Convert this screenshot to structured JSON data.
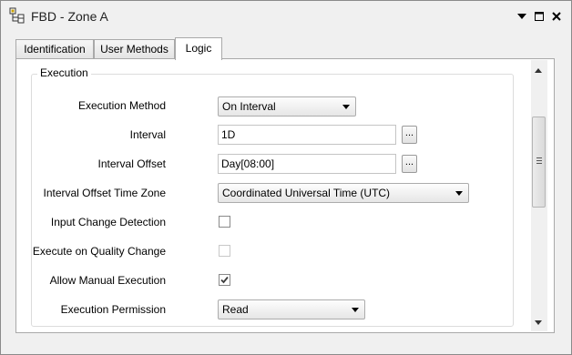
{
  "window": {
    "title": "FBD - Zone A",
    "icons": [
      "function-block-icon",
      "dropdown-arrow-icon",
      "maximize-icon",
      "close-icon"
    ]
  },
  "tabs": [
    {
      "label": "Identification",
      "active": false
    },
    {
      "label": "User Methods",
      "active": false
    },
    {
      "label": "Logic",
      "active": true
    }
  ],
  "execution": {
    "group_title": "Execution",
    "method_label": "Execution Method",
    "method_value": "On Interval",
    "interval_label": "Interval",
    "interval_value": "1D",
    "offset_label": "Interval Offset",
    "offset_value": "Day[08:00]",
    "timezone_label": "Interval Offset Time Zone",
    "timezone_value": "Coordinated Universal Time (UTC)",
    "input_change_label": "Input Change Detection",
    "input_change_checked": false,
    "quality_change_label": "Execute on Quality Change",
    "quality_change_checked": false,
    "quality_change_enabled": false,
    "manual_label": "Allow Manual Execution",
    "manual_checked": true,
    "permission_label": "Execution Permission",
    "permission_value": "Read",
    "ellipsis": "..."
  },
  "colors": {
    "window_bg": "#f0f0f0",
    "panel_bg": "#ffffff",
    "border": "#a9a9a9",
    "check_mark": "#3c3c3c"
  }
}
